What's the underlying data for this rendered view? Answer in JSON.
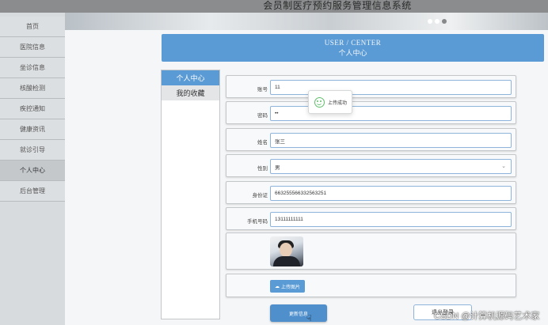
{
  "app": {
    "title": "会员制医疗预约服务管理信息系统"
  },
  "sidebar": {
    "items": [
      {
        "label": "首页"
      },
      {
        "label": "医院信息"
      },
      {
        "label": "坐诊信息"
      },
      {
        "label": "核酸检测"
      },
      {
        "label": "疾控通知"
      },
      {
        "label": "健康资讯"
      },
      {
        "label": "就诊引导"
      },
      {
        "label": "个人中心"
      },
      {
        "label": "后台管理"
      }
    ],
    "active_index": 7
  },
  "header": {
    "en": "USER / CENTER",
    "zh": "个人中心"
  },
  "tabs": [
    {
      "label": "个人中心",
      "active": true
    },
    {
      "label": "我的收藏",
      "active": false
    }
  ],
  "form": {
    "account": {
      "label": "账号",
      "value": "11"
    },
    "password": {
      "label": "密码",
      "value": "••"
    },
    "name": {
      "label": "姓名",
      "value": "张三"
    },
    "gender": {
      "label": "性别",
      "value": "男"
    },
    "id_card": {
      "label": "身份证",
      "value": "663255566332563251"
    },
    "phone": {
      "label": "手机号码",
      "value": "13111111111"
    },
    "upload_label": "上传图片",
    "update_label": "更新信息",
    "logout_label": "退出登录"
  },
  "toast": {
    "message": "上传成功"
  },
  "watermark": "CSDN @计算机源码艺术家",
  "colors": {
    "accent": "#5b9bd5",
    "success": "#5fbf6a"
  }
}
